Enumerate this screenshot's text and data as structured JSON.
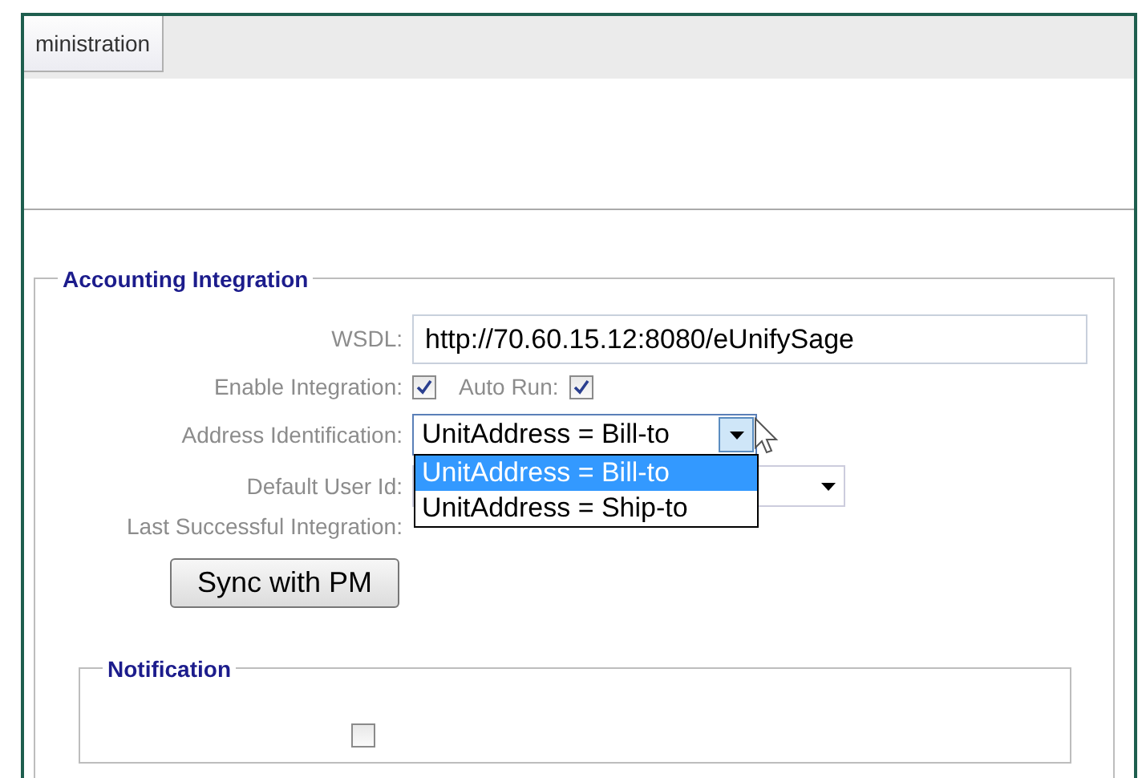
{
  "tabs": [
    {
      "label": "ministration",
      "selected": true
    }
  ],
  "accounting": {
    "legend": "Accounting Integration",
    "wsdl": {
      "label": "WSDL:",
      "value": "http://70.60.15.12:8080/eUnifySage"
    },
    "enable": {
      "label": "Enable Integration:",
      "checked": true
    },
    "auto_run": {
      "label": "Auto Run:",
      "checked": true
    },
    "address": {
      "label": "Address Identification:",
      "value": "UnitAddress = Bill-to",
      "expanded": true,
      "options": [
        {
          "label": "UnitAddress = Bill-to",
          "selected": true
        },
        {
          "label": "UnitAddress = Ship-to",
          "selected": false
        }
      ]
    },
    "default_user": {
      "label": "Default User Id:"
    },
    "last_success": {
      "label": "Last Successful Integration:"
    },
    "sync_button": "Sync with PM"
  },
  "notification": {
    "legend": "Notification",
    "checkbox": {
      "checked": false
    }
  }
}
